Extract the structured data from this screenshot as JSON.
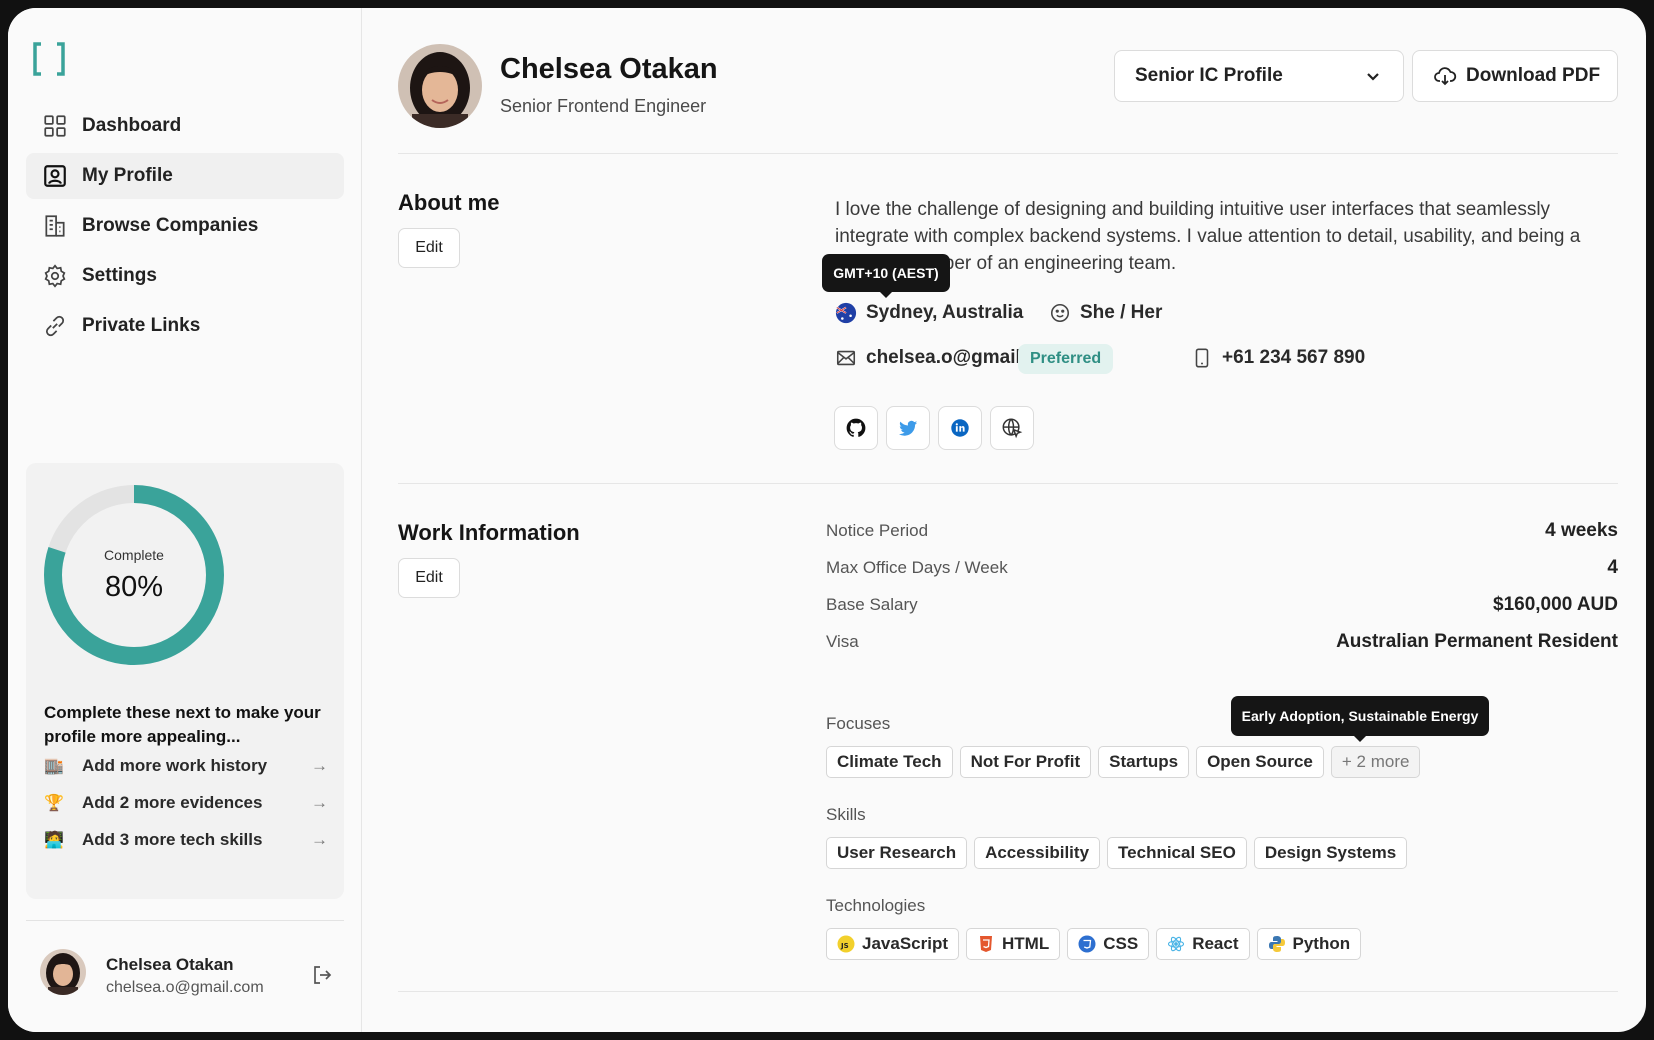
{
  "sidebar": {
    "nav": [
      {
        "label": "Dashboard",
        "icon": "grid-icon"
      },
      {
        "label": "My Profile",
        "icon": "profile-icon"
      },
      {
        "label": "Browse Companies",
        "icon": "building-icon"
      },
      {
        "label": "Settings",
        "icon": "gear-icon"
      },
      {
        "label": "Private Links",
        "icon": "link-icon"
      }
    ],
    "progress": {
      "label": "Complete",
      "percent_text": "80%",
      "value": 0.8,
      "color": "#3aa39a"
    },
    "next_title": "Complete these next to make your profile more appealing...",
    "todos": [
      {
        "emoji": "🏬",
        "label": "Add more work history"
      },
      {
        "emoji": "🏆",
        "label": "Add 2 more evidences"
      },
      {
        "emoji": "🧑‍💻",
        "label": "Add 3 more tech skills"
      }
    ],
    "user": {
      "name": "Chelsea Otakan",
      "email": "chelsea.o@gmail.com"
    }
  },
  "header": {
    "name": "Chelsea Otakan",
    "role": "Senior Frontend Engineer",
    "profile_select": "Senior IC Profile",
    "download_label": "Download PDF"
  },
  "about": {
    "title": "About me",
    "edit": "Edit",
    "text": "I love the challenge of designing and building intuitive user interfaces that seamlessly integrate with complex backend systems. I value attention to detail, usability, and being a reliable member of an engineering team.",
    "tooltip": "GMT+10 (AEST)",
    "location": "Sydney, Australia",
    "pronouns": "She / Her",
    "email": "chelsea.o@gmail.com",
    "email_badge": "Preferred",
    "phone": "+61 234 567 890"
  },
  "work": {
    "title": "Work Information",
    "edit": "Edit",
    "fields": [
      {
        "label": "Notice Period",
        "value": "4 weeks"
      },
      {
        "label": "Max Office Days / Week",
        "value": "4"
      },
      {
        "label": "Base Salary",
        "value": "$160,000 AUD"
      },
      {
        "label": "Visa",
        "value": "Australian Permanent Resident"
      }
    ],
    "focuses_label": "Focuses",
    "focuses": [
      "Climate Tech",
      "Not For Profit",
      "Startups",
      "Open Source"
    ],
    "focuses_more": "+ 2 more",
    "focuses_tooltip": "Early Adoption, Sustainable Energy",
    "skills_label": "Skills",
    "skills": [
      "User Research",
      "Accessibility",
      "Technical SEO",
      "Design Systems"
    ],
    "tech_label": "Technologies",
    "technologies": [
      "JavaScript",
      "HTML",
      "CSS",
      "React",
      "Python"
    ]
  }
}
